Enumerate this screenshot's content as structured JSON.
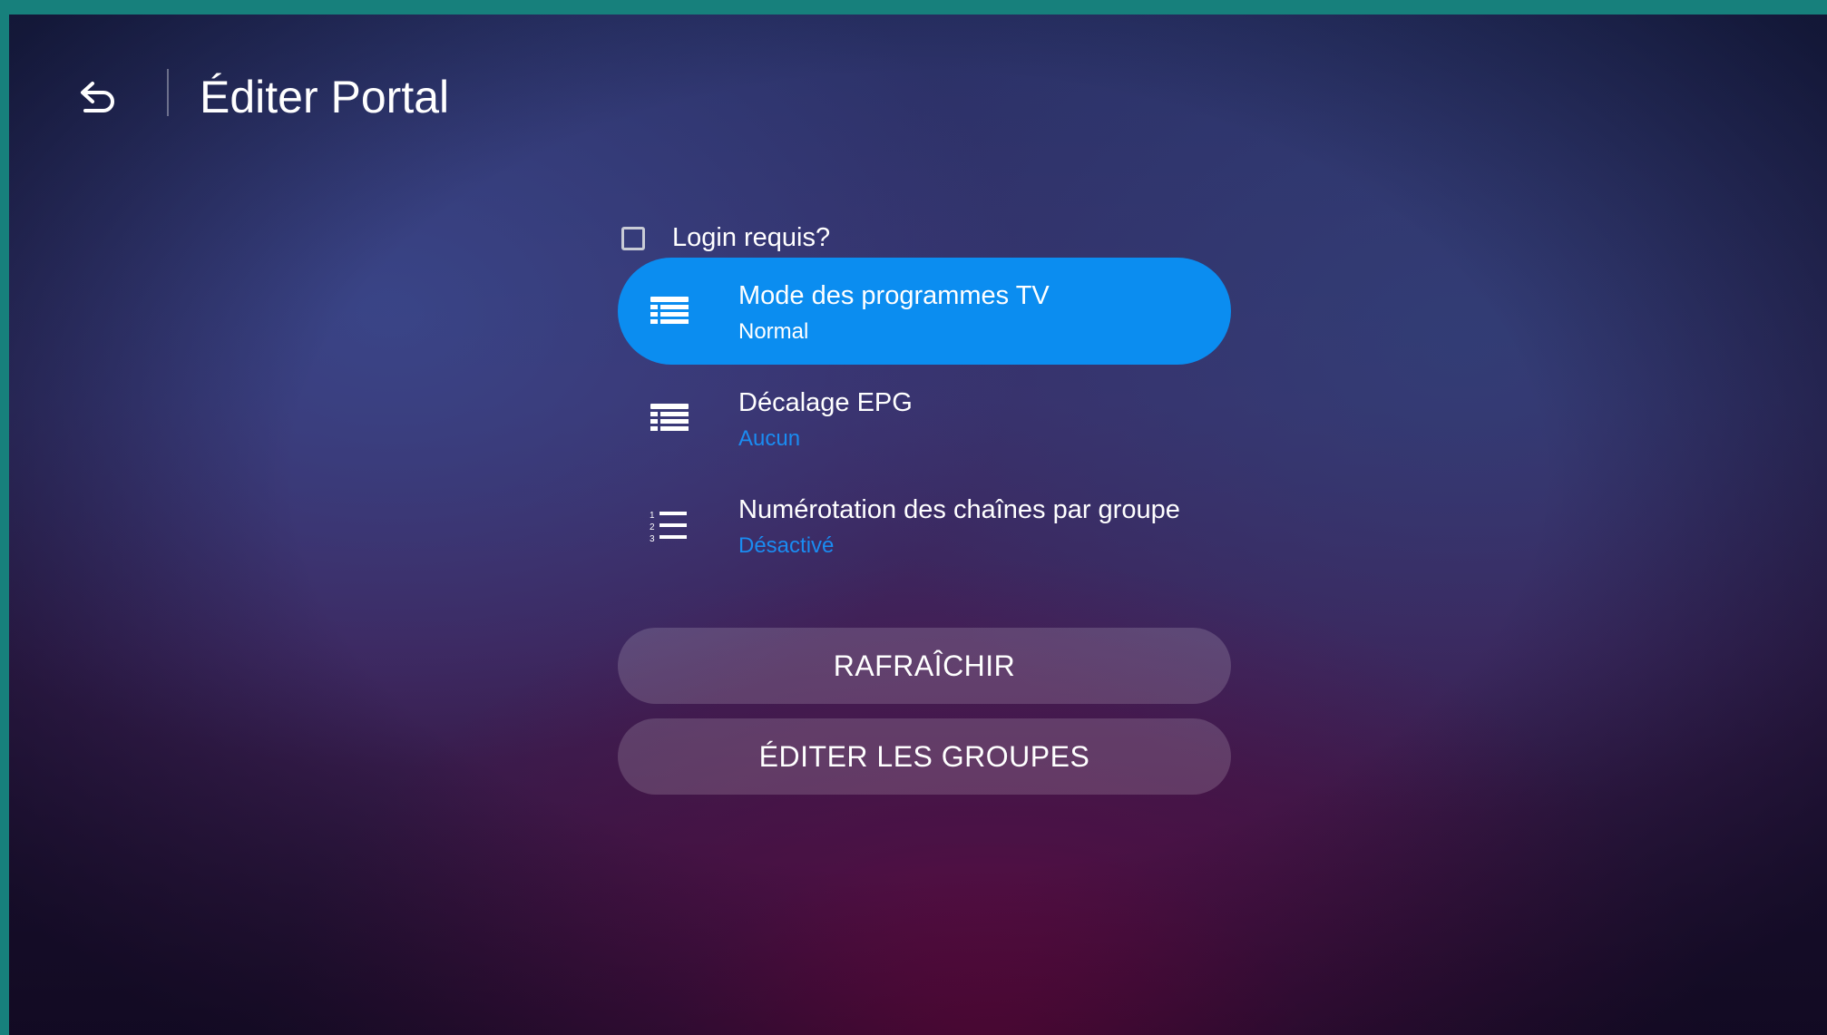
{
  "header": {
    "title": "Éditer Portal"
  },
  "login": {
    "label": "Login requis?",
    "checked": false
  },
  "settings": [
    {
      "label": "Mode des programmes TV",
      "value": "Normal",
      "icon": "list-table-icon"
    },
    {
      "label": "Décalage EPG",
      "value": "Aucun",
      "icon": "list-table-icon"
    },
    {
      "label": "Numérotation des chaînes par groupe",
      "value": "Désactivé",
      "icon": "numbered-list-icon"
    }
  ],
  "buttons": {
    "refresh": "RAFRAÎCHIR",
    "edit_groups": "ÉDITER LES GROUPES"
  },
  "colors": {
    "accent": "#0b8df0",
    "value_text": "#1a8cf2",
    "frame": "#17807c"
  }
}
